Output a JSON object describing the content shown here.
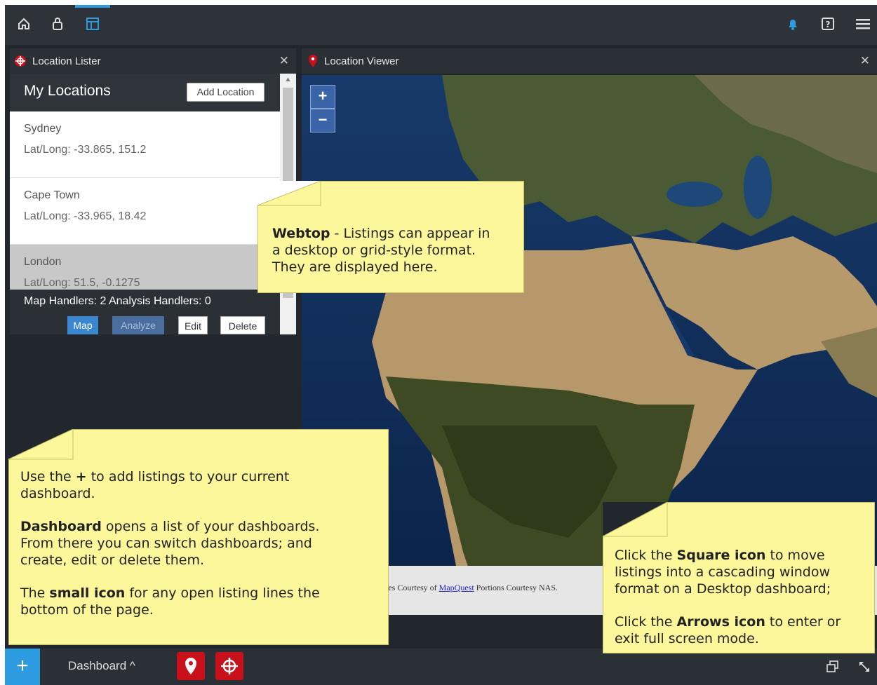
{
  "topbar": {
    "icons": [
      "home-icon",
      "bag-icon",
      "layout-icon",
      "notification-icon",
      "help-icon",
      "menu-icon"
    ],
    "accent_color": "#2c9be0"
  },
  "lister": {
    "window_title": "Location Lister",
    "list_title": "My Locations",
    "add_button": "Add Location",
    "locations": [
      {
        "name": "Sydney",
        "coords": "Lat/Long: -33.865, 151.2"
      },
      {
        "name": "Cape Town",
        "coords": "Lat/Long: -33.965, 18.42"
      },
      {
        "name": "London",
        "coords": "Lat/Long: 51.5, -0.1275"
      }
    ],
    "handlers_text": "Map Handlers: 2 Analysis Handlers: 0",
    "buttons": {
      "map": "Map",
      "analyze": "Analyze",
      "edit": "Edit",
      "delete": "Delete"
    }
  },
  "viewer": {
    "window_title": "Location Viewer",
    "zoom_in": "+",
    "zoom_out": "−",
    "attribution_prefix": "les Courtesy of ",
    "attribution_link": "MapQuest",
    "attribution_suffix": " Portions Courtesy NAS."
  },
  "notes": {
    "webtop": {
      "bold": "Webtop",
      "line1": " - Listings can appear in",
      "line2": "a desktop or grid-style format.",
      "line3": "They are displayed here."
    },
    "dashboard": {
      "l1_pre": "Use the ",
      "l1_bold": "+",
      "l1_post": " to add listings to your current",
      "l2": "dashboard.",
      "l3_bold": "Dashboard",
      "l3_post": " opens a list of your dashboards.",
      "l4": "From there you can switch dashboards; and",
      "l5": "create, edit or delete them.",
      "l6_pre": "The ",
      "l6_bold": "small icon",
      "l6_post": " for any open listing lines the",
      "l7": "bottom of the page."
    },
    "square": {
      "l1_pre": "Click the ",
      "l1_bold": "Square icon",
      "l1_post": " to move",
      "l2": "listings into a cascading window",
      "l3": "format  on a Desktop dashboard;",
      "l4_pre": "Click the ",
      "l4_bold": "Arrows icon",
      "l4_post": " to enter or",
      "l5": "exit full screen mode."
    }
  },
  "taskbar": {
    "plus": "+",
    "dashboard_label": "Dashboard ^",
    "task_icons": [
      "location-pin-icon",
      "crosshair-icon"
    ],
    "right_icons": [
      "cascade-windows-icon",
      "fullscreen-arrows-icon"
    ]
  }
}
